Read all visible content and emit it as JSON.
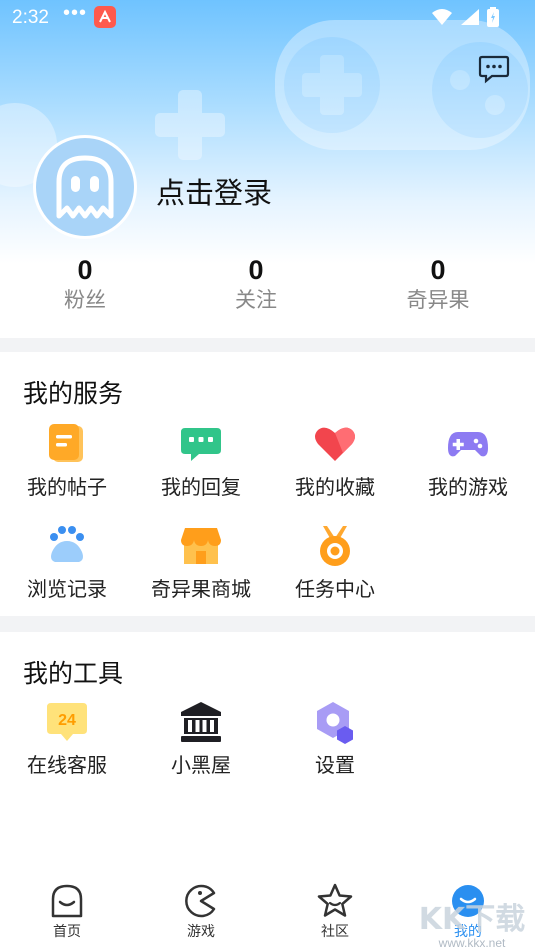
{
  "status_bar": {
    "time": "2:32",
    "dots": "•••"
  },
  "header": {
    "login_text": "点击登录"
  },
  "stats": [
    {
      "value": "0",
      "label": "粉丝"
    },
    {
      "value": "0",
      "label": "关注"
    },
    {
      "value": "0",
      "label": "奇异果"
    }
  ],
  "services": {
    "title": "我的服务",
    "items": [
      {
        "label": "我的帖子",
        "icon": "posts-icon"
      },
      {
        "label": "我的回复",
        "icon": "reply-icon"
      },
      {
        "label": "我的收藏",
        "icon": "favorite-icon"
      },
      {
        "label": "我的游戏",
        "icon": "gamepad-icon"
      },
      {
        "label": "浏览记录",
        "icon": "history-icon"
      },
      {
        "label": "奇异果商城",
        "icon": "shop-icon"
      },
      {
        "label": "任务中心",
        "icon": "medal-icon"
      }
    ]
  },
  "tools": {
    "title": "我的工具",
    "items": [
      {
        "label": "在线客服",
        "icon": "support-24-icon",
        "badge_text": "24"
      },
      {
        "label": "小黑屋",
        "icon": "blackroom-icon"
      },
      {
        "label": "设置",
        "icon": "settings-icon"
      }
    ]
  },
  "tabbar": {
    "items": [
      {
        "label": "首页",
        "icon": "home-icon"
      },
      {
        "label": "游戏",
        "icon": "game-icon"
      },
      {
        "label": "社区",
        "icon": "community-icon"
      },
      {
        "label": "我的",
        "icon": "profile-icon",
        "active": true
      }
    ]
  },
  "watermark": {
    "text": "KK下载",
    "url": "www.kkx.net"
  },
  "colors": {
    "accent": "#2a8ff0",
    "header_top": "#6fc3ff",
    "page_bg": "#f2f3f5"
  }
}
